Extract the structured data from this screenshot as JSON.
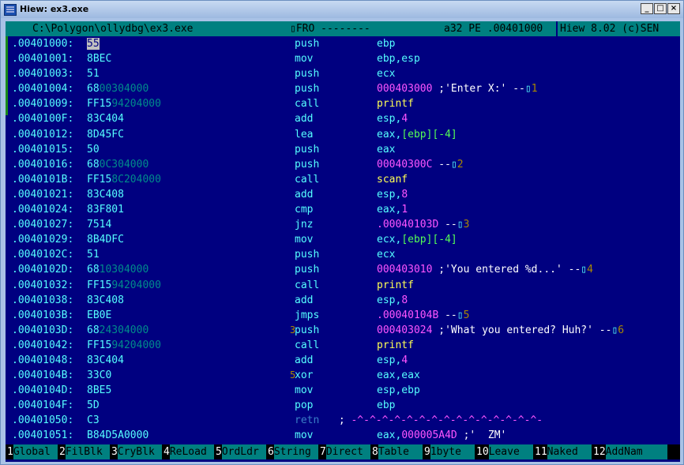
{
  "window": {
    "title": "Hiew: ex3.exe",
    "btn_min": "_",
    "btn_max": "□",
    "btn_close": "×"
  },
  "status": {
    "path": "C:\\Polygon\\ollydbg\\ex3.exe",
    "mode": "▯FRO --------",
    "info": "a32 PE .00401000",
    "version": "Hiew 8.02 (c)SEN"
  },
  "lines": [
    {
      "addr": ".00401000:",
      "b1": "55",
      "b2": "",
      "mnem": "push",
      "op": "ebp",
      "cursor": true
    },
    {
      "addr": ".00401001:",
      "b1": "8BEC",
      "b2": "",
      "mnem": "mov",
      "op": "ebp,esp"
    },
    {
      "addr": ".00401003:",
      "b1": "51",
      "b2": "",
      "mnem": "push",
      "op": "ecx"
    },
    {
      "addr": ".00401004:",
      "b1": "68",
      "b2": "00304000",
      "mnem": "push",
      "num": "000403000",
      "str": " ;'Enter X:' --",
      "ref": "▯",
      "refn": "1"
    },
    {
      "addr": ".00401009:",
      "b1": "FF15",
      "b2": "94204000",
      "mnem": "call",
      "fn": "printf"
    },
    {
      "addr": ".0040100F:",
      "b1": "83C404",
      "b2": "",
      "mnem": "add",
      "op": "esp,",
      "num": "4"
    },
    {
      "addr": ".00401012:",
      "b1": "8D45FC",
      "b2": "",
      "mnem": "lea",
      "op": "eax,",
      "brk": "[ebp][-4]"
    },
    {
      "addr": ".00401015:",
      "b1": "50",
      "b2": "",
      "mnem": "push",
      "op": "eax"
    },
    {
      "addr": ".00401016:",
      "b1": "68",
      "b2": "0C304000",
      "mnem": "push",
      "num": "00040300C",
      "str": " --",
      "ref": "▯",
      "refn": "2"
    },
    {
      "addr": ".0040101B:",
      "b1": "FF15",
      "b2": "8C204000",
      "mnem": "call",
      "fn": "scanf"
    },
    {
      "addr": ".00401021:",
      "b1": "83C408",
      "b2": "",
      "mnem": "add",
      "op": "esp,",
      "num": "8"
    },
    {
      "addr": ".00401024:",
      "b1": "83F801",
      "b2": "",
      "mnem": "cmp",
      "op": "eax,",
      "num": "1"
    },
    {
      "addr": ".00401027:",
      "b1": "7514",
      "b2": "",
      "mnem": "jnz",
      "num": ".00040103D",
      "str": " --",
      "ref": "▯",
      "refn": "3"
    },
    {
      "addr": ".00401029:",
      "b1": "8B4DFC",
      "b2": "",
      "mnem": "mov",
      "op": "ecx,",
      "brk": "[ebp][-4]"
    },
    {
      "addr": ".0040102C:",
      "b1": "51",
      "b2": "",
      "mnem": "push",
      "op": "ecx"
    },
    {
      "addr": ".0040102D:",
      "b1": "68",
      "b2": "10304000",
      "mnem": "push",
      "num": "000403010",
      "str": " ;'You entered %d...' --",
      "ref": "▯",
      "refn": "4"
    },
    {
      "addr": ".00401032:",
      "b1": "FF15",
      "b2": "94204000",
      "mnem": "call",
      "fn": "printf"
    },
    {
      "addr": ".00401038:",
      "b1": "83C408",
      "b2": "",
      "mnem": "add",
      "op": "esp,",
      "num": "8"
    },
    {
      "addr": ".0040103B:",
      "b1": "EB0E",
      "b2": "",
      "mnem": "jmps",
      "num": ".00040104B",
      "str": " --",
      "ref": "▯",
      "refn": "5"
    },
    {
      "addr": ".0040103D:",
      "b1": "68",
      "b2": "24304000",
      "pre": "3",
      "mnem": "push",
      "num": "000403024",
      "str": " ;'What you entered? Huh?' --",
      "ref": "▯",
      "refn": "6"
    },
    {
      "addr": ".00401042:",
      "b1": "FF15",
      "b2": "94204000",
      "mnem": "call",
      "fn": "printf"
    },
    {
      "addr": ".00401048:",
      "b1": "83C404",
      "b2": "",
      "mnem": "add",
      "op": "esp,",
      "num": "4"
    },
    {
      "addr": ".0040104B:",
      "b1": "33C0",
      "b2": "",
      "pre": "5",
      "mnem": "xor",
      "op": "eax,eax"
    },
    {
      "addr": ".0040104D:",
      "b1": "8BE5",
      "b2": "",
      "mnem": "mov",
      "op": "esp,ebp"
    },
    {
      "addr": ".0040104F:",
      "b1": "5D",
      "b2": "",
      "mnem": "pop",
      "op": "ebp"
    },
    {
      "addr": ".00401050:",
      "b1": "C3",
      "b2": "",
      "mnem": "retn",
      "dim": true,
      "str": " ; ",
      "num": "-^-^-^-^-^-^-^-^-^-^-^-^-^-^-^-"
    },
    {
      "addr": ".00401051:",
      "b1": "B84D5A0000",
      "b2": "",
      "mnem": "mov",
      "op": "eax,",
      "num": "000005A4D",
      "str": " ;'  ZM'"
    }
  ],
  "fkeys": [
    {
      "n": "1",
      "label": "Global"
    },
    {
      "n": "2",
      "label": "FilBlk"
    },
    {
      "n": "3",
      "label": "CryBlk"
    },
    {
      "n": "4",
      "label": "ReLoad"
    },
    {
      "n": "5",
      "label": "OrdLdr"
    },
    {
      "n": "6",
      "label": "String"
    },
    {
      "n": "7",
      "label": "Direct"
    },
    {
      "n": "8",
      "label": "Table"
    },
    {
      "n": "9",
      "label": "1byte"
    },
    {
      "n": "10",
      "label": "Leave"
    },
    {
      "n": "11",
      "label": "Naked"
    },
    {
      "n": "12",
      "label": "AddNam"
    }
  ],
  "colors": {
    "background": "#000080",
    "status_bar": "#008080",
    "address": "#55ffff",
    "immediate": "#ff55ff",
    "function": "#ffff55"
  }
}
